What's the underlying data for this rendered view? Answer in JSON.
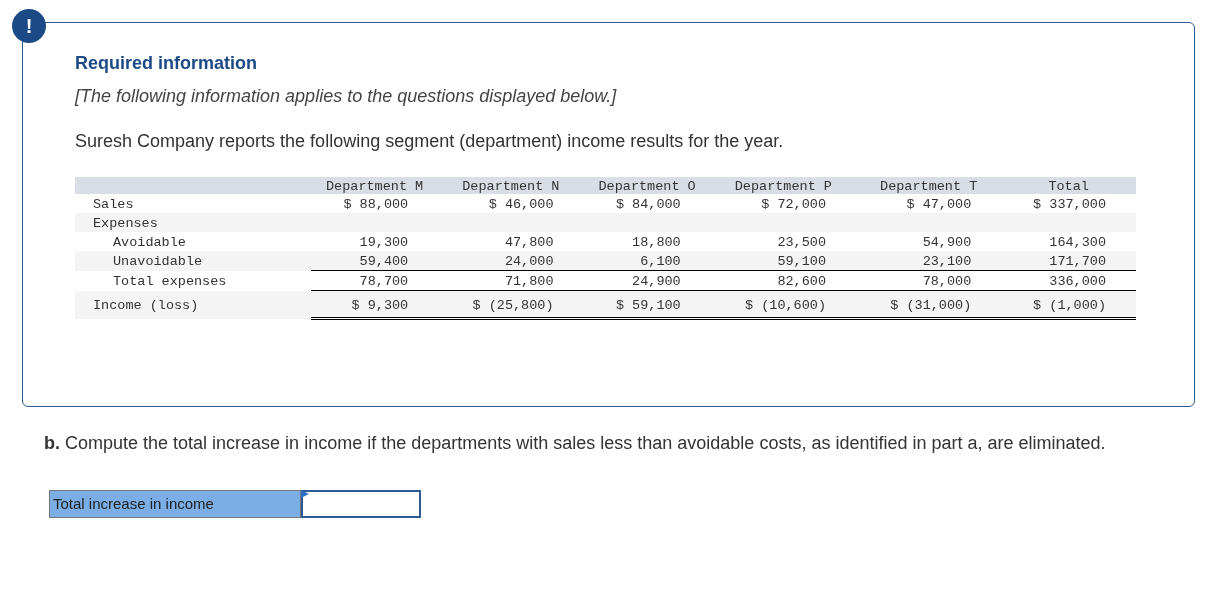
{
  "notice": {
    "badge": "!",
    "title": "Required information",
    "subtitle": "[The following information applies to the questions displayed below.]",
    "intro": "Suresh Company reports the following segment (department) income results for the year."
  },
  "table": {
    "columns": [
      "Department M",
      "Department N",
      "Department O",
      "Department P",
      "Department T",
      "Total"
    ],
    "rows": [
      {
        "label": "Sales",
        "kind": "amount",
        "values": [
          "$ 88,000",
          "$ 46,000",
          "$ 84,000",
          "$ 72,000",
          "$ 47,000",
          "$ 337,000"
        ]
      },
      {
        "label": "Expenses",
        "kind": "section",
        "children": [
          {
            "label": "Avoidable",
            "kind": "amount",
            "values": [
              "19,300",
              "47,800",
              "18,800",
              "23,500",
              "54,900",
              "164,300"
            ]
          },
          {
            "label": "Unavoidable",
            "kind": "amount",
            "values": [
              "59,400",
              "24,000",
              "6,100",
              "59,100",
              "23,100",
              "171,700"
            ]
          },
          {
            "label": "Total expenses",
            "kind": "total",
            "values": [
              "78,700",
              "71,800",
              "24,900",
              "82,600",
              "78,000",
              "336,000"
            ]
          }
        ]
      },
      {
        "label": "Income (loss)",
        "kind": "net",
        "values": [
          "$ 9,300",
          "$ (25,800)",
          "$ 59,100",
          "$ (10,600)",
          "$ (31,000)",
          "$ (1,000)"
        ]
      }
    ]
  },
  "question": "**b.** Compute the total increase in income if the departments with sales less than avoidable costs, as identified in part a, are eliminated.",
  "answer": {
    "label": "Total increase in income"
  }
}
